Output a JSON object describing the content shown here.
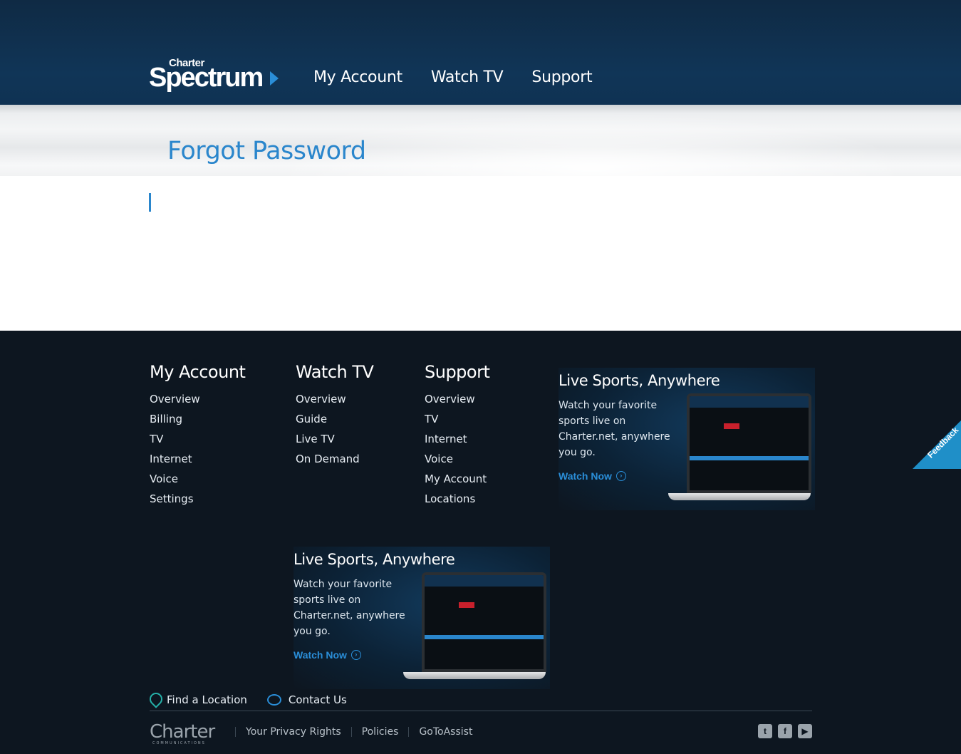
{
  "header": {
    "logo_small": "Charter",
    "logo_main": "Spectrum",
    "nav": [
      "My Account",
      "Watch TV",
      "Support"
    ]
  },
  "page": {
    "title": "Forgot Password"
  },
  "footer": {
    "columns": [
      {
        "title": "My Account",
        "links": [
          "Overview",
          "Billing",
          "TV",
          "Internet",
          "Voice",
          "Settings"
        ]
      },
      {
        "title": "Watch TV",
        "links": [
          "Overview",
          "Guide",
          "Live TV",
          "On Demand"
        ]
      },
      {
        "title": "Support",
        "links": [
          "Overview",
          "TV",
          "Internet",
          "Voice",
          "My Account",
          "Locations"
        ]
      }
    ],
    "promo": {
      "title": "Live Sports, Anywhere",
      "body": "Watch your favorite sports live on Charter.net, anywhere you go.",
      "cta": "Watch Now"
    },
    "find_location": "Find a Location",
    "contact_us": "Contact Us",
    "charter_logo": "Charter",
    "charter_tagline": "COMMUNICATIONS",
    "legal": [
      "Your Privacy Rights",
      "Policies",
      "GoToAssist"
    ],
    "social_icons": [
      "twitter-icon",
      "facebook-icon",
      "youtube-icon"
    ],
    "feedback": "Feedback"
  }
}
